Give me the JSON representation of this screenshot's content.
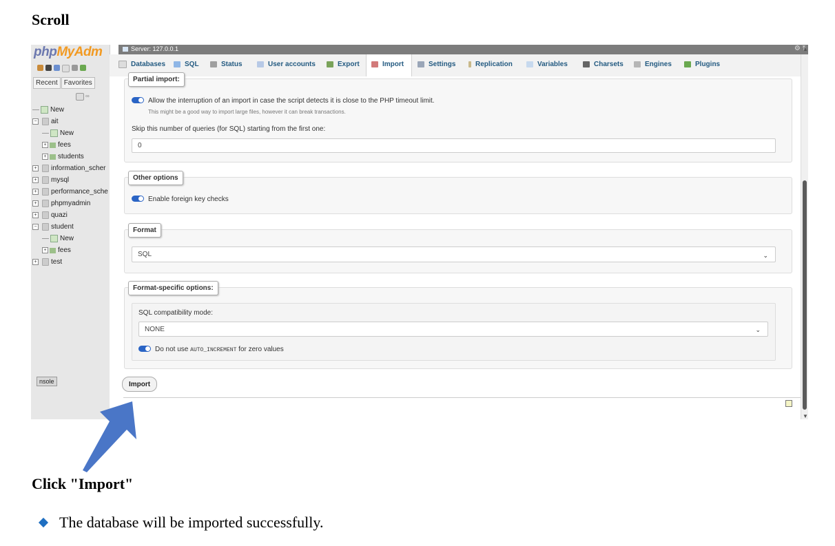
{
  "doc": {
    "heading_scroll": "Scroll",
    "heading_click": "Click \"Import\"",
    "bullet_text": "The database will be imported successfully."
  },
  "nav": {
    "logo_part1": "php",
    "logo_part2": "MyAdm",
    "tab_recent": "Recent",
    "tab_favorites": "Favorites",
    "tree": [
      {
        "label": "New",
        "kind": "new",
        "level": 0
      },
      {
        "label": "ait",
        "kind": "db",
        "level": 0,
        "expanded": true
      },
      {
        "label": "New",
        "kind": "new",
        "level": 1
      },
      {
        "label": "fees",
        "kind": "table",
        "level": 1
      },
      {
        "label": "students",
        "kind": "table",
        "level": 1
      },
      {
        "label": "information_scher",
        "kind": "db",
        "level": 0
      },
      {
        "label": "mysql",
        "kind": "db",
        "level": 0
      },
      {
        "label": "performance_sche",
        "kind": "db",
        "level": 0
      },
      {
        "label": "phpmyadmin",
        "kind": "db",
        "level": 0
      },
      {
        "label": "quazi",
        "kind": "db",
        "level": 0
      },
      {
        "label": "student",
        "kind": "db",
        "level": 0,
        "expanded": true
      },
      {
        "label": "New",
        "kind": "new",
        "level": 1
      },
      {
        "label": "fees",
        "kind": "table",
        "level": 1
      },
      {
        "label": "test",
        "kind": "db",
        "level": 0
      }
    ]
  },
  "topbar": {
    "server_label": "Server: 127.0.0.1"
  },
  "menu": {
    "tabs": [
      "Databases",
      "SQL",
      "Status",
      "User accounts",
      "Export",
      "Import",
      "Settings",
      "Replication",
      "Variables",
      "Charsets",
      "Engines",
      "Plugins"
    ],
    "active": "Import"
  },
  "partial": {
    "legend": "Partial import:",
    "allow_label": "Allow the interruption of an import in case the script detects it is close to the PHP timeout limit.",
    "allow_hint": "This might be a good way to import large files, however it can break transactions.",
    "skip_label": "Skip this number of queries (for SQL) starting from the first one:",
    "skip_value": "0"
  },
  "other": {
    "legend": "Other options",
    "fk_label": "Enable foreign key checks"
  },
  "format": {
    "legend": "Format",
    "selected": "SQL"
  },
  "format_specific": {
    "legend": "Format-specific options:",
    "compat_label": "SQL compatibility mode:",
    "compat_value": "NONE",
    "autoinc_pre": "Do not use",
    "autoinc_code": "AUTO_INCREMENT",
    "autoinc_post": "for zero values"
  },
  "actions": {
    "import_button": "Import",
    "console_label": "nsole"
  },
  "colors": {
    "arrow": "#4a76c7",
    "toggle_on": "#2a64c5",
    "tab_text": "#235a81",
    "bullet": "#1f6fc1"
  }
}
